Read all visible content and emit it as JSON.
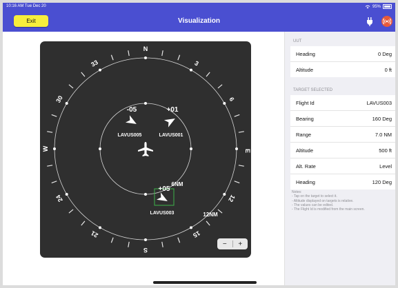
{
  "status_bar": {
    "time": "10:16 AM  Tue Dec 20",
    "battery": "95%"
  },
  "nav": {
    "exit_label": "Exit",
    "title": "Visualization"
  },
  "radar": {
    "compass": {
      "north": "N",
      "east": "E",
      "south": "S",
      "west": "W",
      "n3": "3",
      "n6": "6",
      "n12": "12",
      "n15": "15",
      "n21": "21",
      "n24": "24",
      "n30": "30",
      "n33": "33"
    },
    "range_labels": {
      "inner": "6NM",
      "outer": "12NM"
    },
    "targets": [
      {
        "id": "LAVUS005",
        "rel_alt": "-05",
        "heading_deg": 120
      },
      {
        "id": "LAVUS001",
        "rel_alt": "+01",
        "heading_deg": 60
      },
      {
        "id": "LAVUS003",
        "rel_alt": "+05",
        "heading_deg": 120,
        "selected": true
      }
    ],
    "zoom": {
      "minus": "−",
      "plus": "+"
    }
  },
  "uut": {
    "header": "UUT",
    "rows": [
      {
        "label": "Heading",
        "value": "0 Deg"
      },
      {
        "label": "Altitude",
        "value": "0 ft"
      }
    ]
  },
  "target_selected": {
    "header": "TARGET SELECTED",
    "rows": [
      {
        "label": "Flight Id",
        "value": "LAVUS003"
      },
      {
        "label": "Bearing",
        "value": "160 Deg"
      },
      {
        "label": "Range",
        "value": "7.0 NM"
      },
      {
        "label": "Altitude",
        "value": "500 ft"
      },
      {
        "label": "Alt. Rate",
        "value": "Level"
      },
      {
        "label": "Heading",
        "value": "120 Deg"
      }
    ]
  },
  "notes": {
    "title": "Notes:",
    "lines": [
      "- Tap on the target to select it.",
      "- Altitude displayed on targets is relative.",
      "- The values can be edited.",
      "- The Flight Id is modified from the main screen."
    ]
  },
  "colors": {
    "accent": "#4a4fd1",
    "exit_button": "#f7ee3c",
    "alert": "#e85a3a",
    "radar_bg": "#2f2f2f",
    "selection": "#3db34a"
  }
}
